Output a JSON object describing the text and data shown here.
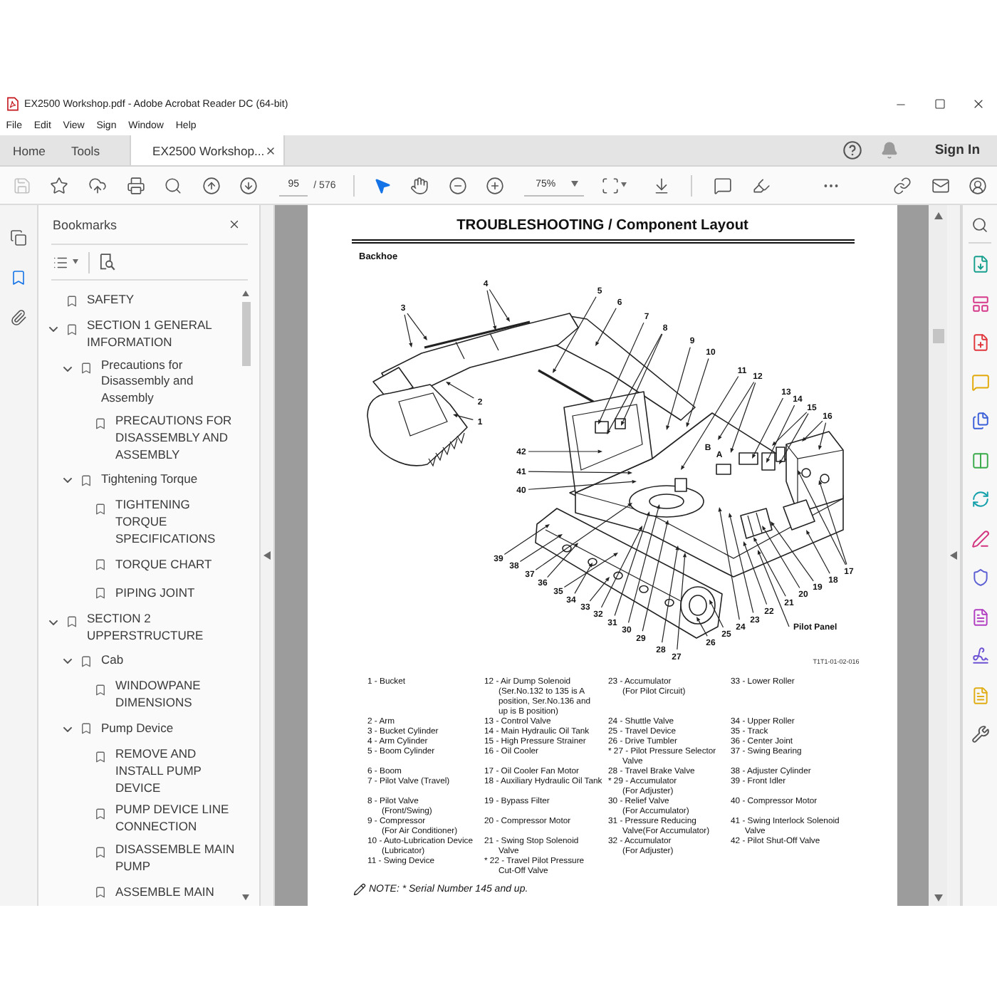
{
  "window": {
    "title": "EX2500 Workshop.pdf - Adobe Acrobat Reader DC (64-bit)"
  },
  "menu": [
    "File",
    "Edit",
    "View",
    "Sign",
    "Window",
    "Help"
  ],
  "tabs": [
    {
      "kind": "nav",
      "label": "Home",
      "selected": false
    },
    {
      "kind": "nav",
      "label": "Tools",
      "selected": false
    },
    {
      "kind": "document",
      "label": "EX2500 Workshop...",
      "selected": true
    }
  ],
  "account": {
    "label": "Sign In"
  },
  "toolbar": {
    "save": {
      "disabled": true
    },
    "page_number": "95",
    "page_count": "/ 576",
    "tools": [
      {
        "kind": "select",
        "selected": true
      },
      {
        "kind": "hand",
        "selected": false
      }
    ],
    "zoom": "75%"
  },
  "left_rail": [
    {
      "kind": "pages",
      "selected": false
    },
    {
      "kind": "bookmarks",
      "selected": true
    },
    {
      "kind": "attachments",
      "selected": false
    }
  ],
  "bookmarks": {
    "title": "Bookmarks",
    "items": [
      {
        "label": "SAFETY"
      },
      {
        "label": "SECTION 1 GENERAL IMFORMATION",
        "expanded": true,
        "children": [
          {
            "label": "Precautions for Disassembly and Assembly",
            "expanded": true,
            "children": [
              {
                "label": "PRECAUTIONS FOR DISASSEMBLY AND ASSEMBLY"
              }
            ]
          },
          {
            "label": "Tightening Torque",
            "expanded": true,
            "children": [
              {
                "label": "TIGHTENING TORQUE SPECIFICATIONS"
              },
              {
                "label": "TORQUE CHART"
              },
              {
                "label": "PIPING JOINT"
              }
            ]
          }
        ]
      },
      {
        "label": "SECTION 2 UPPERSTRUCTURE",
        "expanded": true,
        "children": [
          {
            "label": "Cab",
            "expanded": true,
            "children": [
              {
                "label": "WINDOWPANE DIMENSIONS"
              }
            ]
          },
          {
            "label": "Pump Device",
            "expanded": true,
            "children": [
              {
                "label": "REMOVE AND INSTALL PUMP DEVICE"
              },
              {
                "label": "PUMP DEVICE LINE CONNECTION"
              },
              {
                "label": "DISASSEMBLE MAIN PUMP"
              },
              {
                "label": "ASSEMBLE MAIN"
              }
            ]
          }
        ]
      }
    ]
  },
  "document": {
    "title": "TROUBLESHOOTING / Component Layout",
    "subtitle": "Backhoe",
    "callouts": [
      "4",
      "5",
      "6",
      "3",
      "7",
      "8",
      "9",
      "10",
      "11",
      "12",
      "13",
      "14",
      "2",
      "15",
      "16",
      "1",
      "B",
      "42",
      "A",
      "41",
      "40",
      "39",
      "38",
      "17",
      "37",
      "18",
      "36",
      "19",
      "35",
      "20",
      "34",
      "21",
      "33",
      "22",
      "32",
      "23",
      "31",
      "24",
      "Pilot Panel",
      "30",
      "25",
      "29",
      "26",
      "28",
      "27"
    ],
    "figure_id": "T1T1-01-02-016",
    "legend": [
      [
        {
          "label": "1 -",
          "lines": [
            "Bucket"
          ]
        },
        {
          "label": "2 -",
          "lines": [
            "Arm"
          ]
        },
        {
          "label": "3 -",
          "lines": [
            "Bucket Cylinder"
          ]
        },
        {
          "label": "4 -",
          "lines": [
            "Arm Cylinder"
          ]
        },
        {
          "label": "5 -",
          "lines": [
            "Boom Cylinder"
          ]
        },
        {
          "label": "6 -",
          "lines": [
            "Boom"
          ]
        },
        {
          "label": "7 -",
          "lines": [
            "Pilot Valve (Travel)"
          ]
        },
        {
          "label": "8 -",
          "lines": [
            "Pilot Valve",
            "(Front/Swing)"
          ]
        },
        {
          "label": "9 -",
          "lines": [
            "Compressor",
            "(For Air Conditioner)"
          ]
        },
        {
          "label": "10 -",
          "lines": [
            "Auto-Lubrication Device",
            "(Lubricator)"
          ]
        },
        {
          "label": "11 -",
          "lines": [
            "Swing Device"
          ]
        }
      ],
      [
        {
          "label": "12 -",
          "lines": [
            "Air Dump Solenoid",
            "(Ser.No.132 to 135 is A",
            "position, Ser.No.136 and",
            "up is B position)"
          ]
        },
        {
          "label": "13 -",
          "lines": [
            "Control Valve"
          ]
        },
        {
          "label": "14 -",
          "lines": [
            "Main Hydraulic Oil Tank"
          ]
        },
        {
          "label": "15 -",
          "lines": [
            "High Pressure Strainer"
          ]
        },
        {
          "label": "16 -",
          "lines": [
            "Oil Cooler"
          ]
        },
        {
          "label": "17 -",
          "lines": [
            "Oil Cooler Fan Motor"
          ]
        },
        {
          "label": "18 -",
          "lines": [
            "Auxiliary Hydraulic Oil Tank"
          ]
        },
        {
          "label": "19 -",
          "lines": [
            "Bypass Filter"
          ]
        },
        {
          "label": "20 -",
          "lines": [
            "Compressor Motor"
          ]
        },
        {
          "label": "21 -",
          "lines": [
            "Swing Stop Solenoid",
            "Valve"
          ]
        },
        {
          "label": "* 22 -",
          "lines": [
            "Travel Pilot Pressure",
            "Cut-Off Valve"
          ]
        }
      ],
      [
        {
          "label": "23 -",
          "lines": [
            "Accumulator",
            "(For Pilot Circuit)"
          ]
        },
        {
          "label": "24 -",
          "lines": [
            "Shuttle Valve"
          ]
        },
        {
          "label": "25 -",
          "lines": [
            "Travel Device"
          ]
        },
        {
          "label": "26 -",
          "lines": [
            "Drive Tumbler"
          ]
        },
        {
          "label": "* 27 -",
          "lines": [
            "Pilot Pressure Selector",
            "Valve"
          ]
        },
        {
          "label": "28 -",
          "lines": [
            "Travel Brake Valve"
          ]
        },
        {
          "label": "* 29 -",
          "lines": [
            "Accumulator",
            "(For Adjuster)"
          ]
        },
        {
          "label": "30 -",
          "lines": [
            "Relief Valve",
            "(For Accumulator)"
          ]
        },
        {
          "label": "31 -",
          "lines": [
            "Pressure Reducing",
            "Valve(For Accumulator)"
          ]
        },
        {
          "label": "32 -",
          "lines": [
            "Accumulator",
            "(For Adjuster)"
          ]
        }
      ],
      [
        {
          "label": "33 -",
          "lines": [
            "Lower Roller"
          ]
        },
        {
          "label": "34 -",
          "lines": [
            "Upper Roller"
          ]
        },
        {
          "label": "35 -",
          "lines": [
            "Track"
          ]
        },
        {
          "label": "36 -",
          "lines": [
            "Center Joint"
          ]
        },
        {
          "label": "37 -",
          "lines": [
            "Swing Bearing"
          ]
        },
        {
          "label": "38 -",
          "lines": [
            "Adjuster Cylinder"
          ]
        },
        {
          "label": "39 -",
          "lines": [
            "Front Idler"
          ]
        },
        {
          "label": "40 -",
          "lines": [
            "Compressor Motor"
          ]
        },
        {
          "label": "41 -",
          "lines": [
            "Swing Interlock Solenoid",
            "Valve"
          ]
        },
        {
          "label": "42 -",
          "lines": [
            "Pilot Shut-Off Valve"
          ]
        }
      ]
    ],
    "note": "NOTE: * Serial Number 145 and up."
  }
}
